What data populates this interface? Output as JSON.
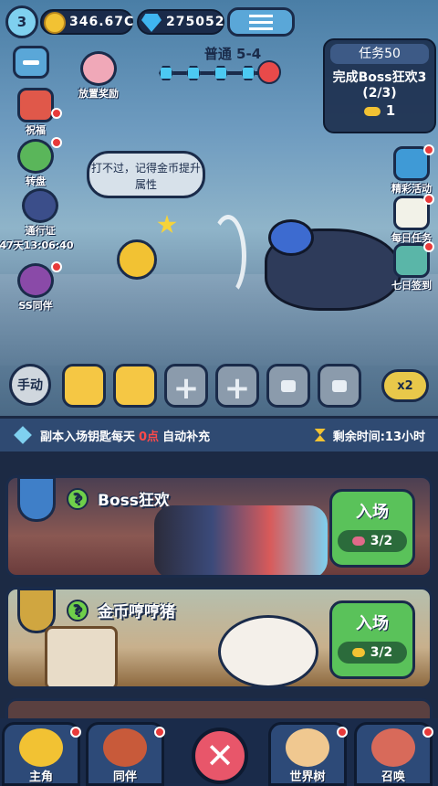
{
  "header": {
    "level": "3",
    "coins": "346.67C",
    "gems": "275052"
  },
  "stage": {
    "title": "普通 5-4"
  },
  "quest": {
    "title": "任务50",
    "desc": "完成Boss狂欢3",
    "progress": "(2/3)",
    "reward_count": "1"
  },
  "left_menu": {
    "idle": "放置奖励",
    "blessing": "祝福",
    "wheel": "转盘",
    "pass": "通行证",
    "pass_timer": "47天13:06:40",
    "ssr": "SS同伴"
  },
  "right_menu": {
    "events": "精彩活动",
    "daily": "每日任务",
    "signin": "七日签到"
  },
  "speech": {
    "text": "打不过，记得金币提升属性"
  },
  "battle": {
    "manual": "手动",
    "speed": "x2"
  },
  "notice": {
    "text_a": "副本入场钥匙每天",
    "text_red": "0点",
    "text_b": "自动补充",
    "timer": "剩余时间:13小时"
  },
  "dungeons": [
    {
      "name": "Boss狂欢",
      "enter": "入场",
      "keys": "3/2"
    },
    {
      "name": "金币哼哼猪",
      "enter": "入场",
      "keys": "3/2"
    }
  ],
  "nav": {
    "hero": "主角",
    "partner": "同伴",
    "world_tree": "世界树",
    "summon": "召唤"
  },
  "colors": {
    "accent": "#5ac25a",
    "notice_red": "#ff4a4a",
    "dark": "#1a2b4a"
  }
}
